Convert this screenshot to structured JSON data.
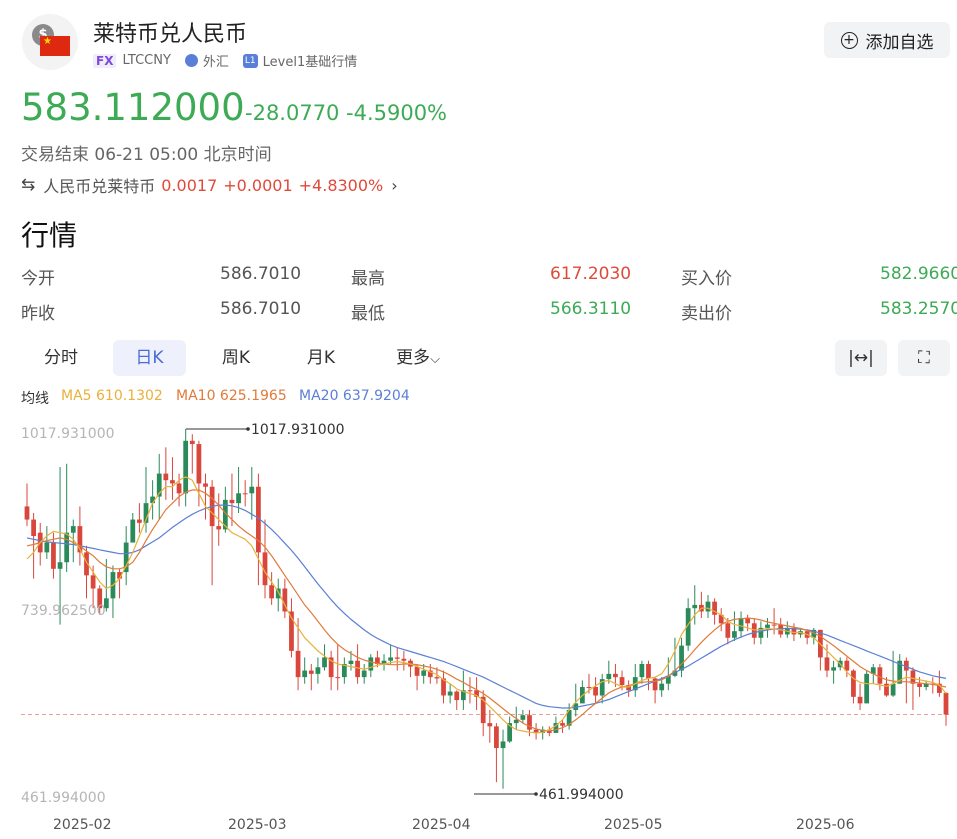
{
  "header": {
    "title": "莱特币兑人民币",
    "tag_fx": "FX",
    "symbol": "LTCCNY",
    "market": "外汇",
    "level_badge": "L1",
    "level": "Level1基础行情",
    "add_button": "添加自选"
  },
  "quote": {
    "price": "583.112000",
    "change": "-28.0770",
    "change_pct": "-4.5900%",
    "status": "交易结束 06-21 05:00 北京时间"
  },
  "reverse_pair": {
    "name": "人民币兑莱特币",
    "price": "0.0017",
    "change": "+0.0001",
    "change_pct": "+4.8300%"
  },
  "section_title": "行情",
  "stats": [
    {
      "label": "今开",
      "value": "586.7010",
      "color": "neutral"
    },
    {
      "label": "最高",
      "value": "617.2030",
      "color": "red"
    },
    {
      "label": "买入价",
      "value": "582.9660",
      "color": "green"
    },
    {
      "label": "昨收",
      "value": "586.7010",
      "color": "neutral"
    },
    {
      "label": "最低",
      "value": "566.3110",
      "color": "green"
    },
    {
      "label": "卖出价",
      "value": "583.2570",
      "color": "green"
    }
  ],
  "tabs": [
    "分时",
    "日K",
    "周K",
    "月K",
    "更多"
  ],
  "active_tab": "日K",
  "ma_legend": {
    "label": "均线",
    "ma5": "MA5 610.1302",
    "ma10": "MA10 625.1965",
    "ma20": "MA20 637.9204",
    "colors": {
      "ma5": "#e8b13a",
      "ma10": "#e07b3a",
      "ma20": "#5b7fd6"
    }
  },
  "colors": {
    "up": "#d9463b",
    "down": "#2a8a5a",
    "accent": "#4a6cd4",
    "price_green": "#3daa55"
  },
  "chart_data": {
    "type": "candlestick",
    "y_axis_labels": [
      "1017.931000",
      "739.962500",
      "461.994000"
    ],
    "ylim": [
      461.994,
      1017.931
    ],
    "x_labels": [
      "2025-02",
      "2025-03",
      "2025-04",
      "2025-05",
      "2025-06"
    ],
    "max_annotation": "1017.931000",
    "min_annotation": "461.994000",
    "last_price": 583.112,
    "candles": [
      [
        880,
        900,
        935,
        870
      ],
      [
        855,
        880,
        890,
        790
      ],
      [
        830,
        860,
        875,
        810
      ],
      [
        845,
        830,
        870,
        820
      ],
      [
        805,
        845,
        860,
        790
      ],
      [
        815,
        805,
        960,
        720
      ],
      [
        860,
        815,
        965,
        800
      ],
      [
        870,
        860,
        880,
        815
      ],
      [
        830,
        870,
        900,
        810
      ],
      [
        795,
        830,
        840,
        760
      ],
      [
        775,
        795,
        810,
        745
      ],
      [
        745,
        775,
        780,
        735
      ],
      [
        760,
        745,
        820,
        740
      ],
      [
        800,
        760,
        810,
        730
      ],
      [
        790,
        800,
        805,
        760
      ],
      [
        845,
        800,
        870,
        780
      ],
      [
        880,
        845,
        890,
        850
      ],
      [
        875,
        880,
        905,
        860
      ],
      [
        905,
        875,
        960,
        860
      ],
      [
        915,
        905,
        940,
        880
      ],
      [
        950,
        915,
        980,
        880
      ],
      [
        940,
        950,
        990,
        910
      ],
      [
        935,
        940,
        975,
        910
      ],
      [
        920,
        935,
        950,
        900
      ],
      [
        1000,
        920,
        1018,
        900
      ],
      [
        995,
        1000,
        1010,
        950
      ],
      [
        935,
        995,
        1000,
        900
      ],
      [
        930,
        935,
        950,
        880
      ],
      [
        870,
        930,
        940,
        780
      ],
      [
        865,
        870,
        920,
        840
      ],
      [
        910,
        865,
        930,
        860
      ],
      [
        905,
        910,
        950,
        870
      ],
      [
        920,
        905,
        960,
        890
      ],
      [
        920,
        920,
        940,
        900
      ],
      [
        930,
        920,
        960,
        880
      ],
      [
        830,
        930,
        950,
        780
      ],
      [
        780,
        830,
        880,
        760
      ],
      [
        760,
        780,
        800,
        750
      ],
      [
        775,
        760,
        790,
        740
      ],
      [
        740,
        775,
        790,
        730
      ],
      [
        680,
        740,
        760,
        670
      ],
      [
        640,
        680,
        730,
        620
      ],
      [
        650,
        640,
        670,
        630
      ],
      [
        645,
        650,
        660,
        620
      ],
      [
        655,
        645,
        670,
        630
      ],
      [
        670,
        655,
        690,
        650
      ],
      [
        640,
        670,
        680,
        620
      ],
      [
        640,
        640,
        690,
        620
      ],
      [
        660,
        640,
        670,
        630
      ],
      [
        665,
        660,
        680,
        650
      ],
      [
        640,
        665,
        690,
        630
      ],
      [
        650,
        640,
        660,
        630
      ],
      [
        670,
        650,
        675,
        640
      ],
      [
        660,
        670,
        680,
        655
      ],
      [
        665,
        660,
        675,
        650
      ],
      [
        670,
        665,
        690,
        660
      ],
      [
        668,
        670,
        685,
        650
      ],
      [
        665,
        668,
        680,
        650
      ],
      [
        656,
        665,
        668,
        640
      ],
      [
        642,
        656,
        660,
        620
      ],
      [
        650,
        642,
        660,
        630
      ],
      [
        640,
        650,
        660,
        630
      ],
      [
        638,
        640,
        655,
        630
      ],
      [
        612,
        638,
        650,
        600
      ],
      [
        618,
        612,
        630,
        600
      ],
      [
        605,
        618,
        620,
        590
      ],
      [
        620,
        605,
        650,
        590
      ],
      [
        620,
        620,
        640,
        600
      ],
      [
        610,
        620,
        640,
        590
      ],
      [
        570,
        610,
        620,
        550
      ],
      [
        565,
        570,
        590,
        540
      ],
      [
        532,
        565,
        570,
        480
      ],
      [
        542,
        532,
        560,
        470
      ],
      [
        570,
        542,
        580,
        540
      ],
      [
        575,
        570,
        595,
        560
      ],
      [
        582,
        575,
        590,
        570
      ],
      [
        560,
        582,
        590,
        550
      ],
      [
        555,
        560,
        570,
        545
      ],
      [
        560,
        555,
        565,
        545
      ],
      [
        555,
        560,
        565,
        550
      ],
      [
        570,
        555,
        580,
        560
      ],
      [
        566,
        570,
        575,
        555
      ],
      [
        590,
        566,
        600,
        560
      ],
      [
        600,
        590,
        630,
        580
      ],
      [
        625,
        600,
        635,
        610
      ],
      [
        625,
        625,
        645,
        615
      ],
      [
        612,
        625,
        640,
        600
      ],
      [
        637,
        612,
        645,
        600
      ],
      [
        645,
        637,
        665,
        630
      ],
      [
        640,
        645,
        660,
        625
      ],
      [
        628,
        640,
        650,
        620
      ],
      [
        620,
        628,
        635,
        610
      ],
      [
        640,
        620,
        660,
        610
      ],
      [
        660,
        640,
        665,
        630
      ],
      [
        638,
        660,
        665,
        620
      ],
      [
        620,
        638,
        640,
        600
      ],
      [
        630,
        620,
        640,
        610
      ],
      [
        642,
        630,
        670,
        620
      ],
      [
        650,
        642,
        700,
        640
      ],
      [
        688,
        650,
        700,
        640
      ],
      [
        745,
        688,
        760,
        680
      ],
      [
        750,
        745,
        780,
        720
      ],
      [
        740,
        750,
        770,
        730
      ],
      [
        755,
        740,
        765,
        730
      ],
      [
        735,
        755,
        760,
        720
      ],
      [
        722,
        735,
        745,
        710
      ],
      [
        700,
        722,
        730,
        690
      ],
      [
        710,
        700,
        740,
        695
      ],
      [
        730,
        710,
        740,
        700
      ],
      [
        722,
        730,
        735,
        710
      ],
      [
        700,
        722,
        730,
        690
      ],
      [
        715,
        700,
        725,
        690
      ],
      [
        720,
        715,
        730,
        700
      ],
      [
        720,
        720,
        745,
        705
      ],
      [
        705,
        720,
        730,
        700
      ],
      [
        715,
        705,
        725,
        700
      ],
      [
        705,
        715,
        722,
        695
      ],
      [
        710,
        705,
        715,
        700
      ],
      [
        700,
        710,
        710,
        690
      ],
      [
        712,
        700,
        715,
        690
      ],
      [
        670,
        712,
        712,
        650
      ],
      [
        650,
        670,
        690,
        640
      ],
      [
        655,
        650,
        665,
        630
      ],
      [
        665,
        655,
        670,
        650
      ],
      [
        650,
        665,
        670,
        640
      ],
      [
        610,
        650,
        652,
        600
      ],
      [
        600,
        610,
        630,
        590
      ],
      [
        645,
        600,
        650,
        640
      ],
      [
        655,
        645,
        660,
        630
      ],
      [
        630,
        655,
        660,
        620
      ],
      [
        612,
        630,
        640,
        610
      ],
      [
        630,
        612,
        680,
        610
      ],
      [
        665,
        630,
        675,
        630
      ],
      [
        650,
        665,
        670,
        600
      ],
      [
        630,
        650,
        655,
        590
      ],
      [
        625,
        630,
        640,
        610
      ],
      [
        630,
        625,
        635,
        620
      ],
      [
        630,
        630,
        640,
        615
      ],
      [
        616,
        630,
        650,
        610
      ],
      [
        583,
        616,
        617,
        566
      ]
    ],
    "ma5": [
      820,
      830,
      845,
      855,
      862,
      860,
      858,
      850,
      835,
      815,
      800,
      785,
      775,
      780,
      790,
      810,
      830,
      855,
      880,
      905,
      920,
      930,
      930,
      940,
      945,
      940,
      920,
      900,
      890,
      880,
      870,
      860,
      855,
      850,
      840,
      820,
      800,
      785,
      770,
      750,
      730,
      715,
      700,
      690,
      680,
      672,
      665,
      660,
      658,
      656,
      654,
      652,
      655,
      658,
      660,
      662,
      664,
      662,
      660,
      656,
      652,
      648,
      644,
      636,
      630,
      622,
      618,
      615,
      612,
      605,
      595,
      585,
      575,
      566,
      560,
      558,
      556,
      555,
      556,
      560,
      566,
      575,
      590,
      602,
      612,
      620,
      627,
      633,
      635,
      630,
      625,
      625,
      630,
      635,
      638,
      640,
      645,
      660,
      680,
      705,
      720,
      735,
      745,
      745,
      740,
      735,
      725,
      720,
      718,
      715,
      712,
      712,
      714,
      713,
      712,
      710,
      708,
      708,
      705,
      700,
      690,
      680,
      670,
      660,
      648,
      638,
      632,
      630,
      630,
      628,
      626,
      630,
      635,
      640,
      638,
      636,
      634,
      632,
      628,
      615
    ],
    "ma10": [
      840,
      842,
      845,
      848,
      850,
      852,
      850,
      845,
      840,
      832,
      825,
      815,
      808,
      805,
      805,
      808,
      815,
      830,
      848,
      865,
      880,
      895,
      905,
      915,
      922,
      925,
      925,
      920,
      912,
      902,
      890,
      880,
      870,
      862,
      855,
      848,
      838,
      825,
      810,
      795,
      780,
      765,
      750,
      738,
      725,
      712,
      700,
      690,
      682,
      676,
      670,
      666,
      663,
      661,
      660,
      659,
      659,
      660,
      660,
      659,
      657,
      655,
      652,
      648,
      643,
      637,
      632,
      626,
      621,
      615,
      608,
      600,
      592,
      584,
      577,
      570,
      565,
      561,
      559,
      558,
      560,
      563,
      568,
      575,
      583,
      592,
      600,
      608,
      616,
      621,
      625,
      627,
      630,
      632,
      633,
      634,
      636,
      641,
      650,
      660,
      670,
      682,
      693,
      703,
      712,
      720,
      725,
      728,
      729,
      730,
      729,
      727,
      724,
      722,
      720,
      718,
      716,
      714,
      711,
      707,
      702,
      695,
      688,
      680,
      672,
      664,
      656,
      650,
      645,
      640,
      636,
      634,
      633,
      633,
      632,
      631,
      630,
      629,
      627,
      625
    ],
    "ma20": [
      852,
      850,
      848,
      846,
      845,
      844,
      843,
      842,
      840,
      838,
      836,
      834,
      832,
      830,
      828,
      828,
      830,
      834,
      840,
      846,
      852,
      860,
      868,
      875,
      882,
      888,
      893,
      897,
      900,
      902,
      902,
      901,
      898,
      894,
      888,
      882,
      874,
      865,
      855,
      844,
      833,
      821,
      808,
      795,
      782,
      770,
      758,
      747,
      737,
      728,
      720,
      712,
      705,
      699,
      694,
      689,
      685,
      682,
      679,
      676,
      673,
      670,
      667,
      664,
      660,
      656,
      652,
      648,
      644,
      640,
      635,
      630,
      625,
      620,
      615,
      610,
      605,
      600,
      597,
      595,
      594,
      593,
      593,
      594,
      596,
      598,
      600,
      603,
      606,
      610,
      614,
      618,
      622,
      626,
      630,
      634,
      638,
      642,
      647,
      652,
      657,
      663,
      669,
      675,
      681,
      687,
      692,
      697,
      701,
      705,
      708,
      710,
      712,
      713,
      714,
      714,
      714,
      713,
      712,
      710,
      707,
      704,
      700,
      696,
      692,
      688,
      684,
      680,
      676,
      672,
      668,
      664,
      660,
      656,
      652,
      648,
      645,
      642,
      640,
      638
    ]
  }
}
